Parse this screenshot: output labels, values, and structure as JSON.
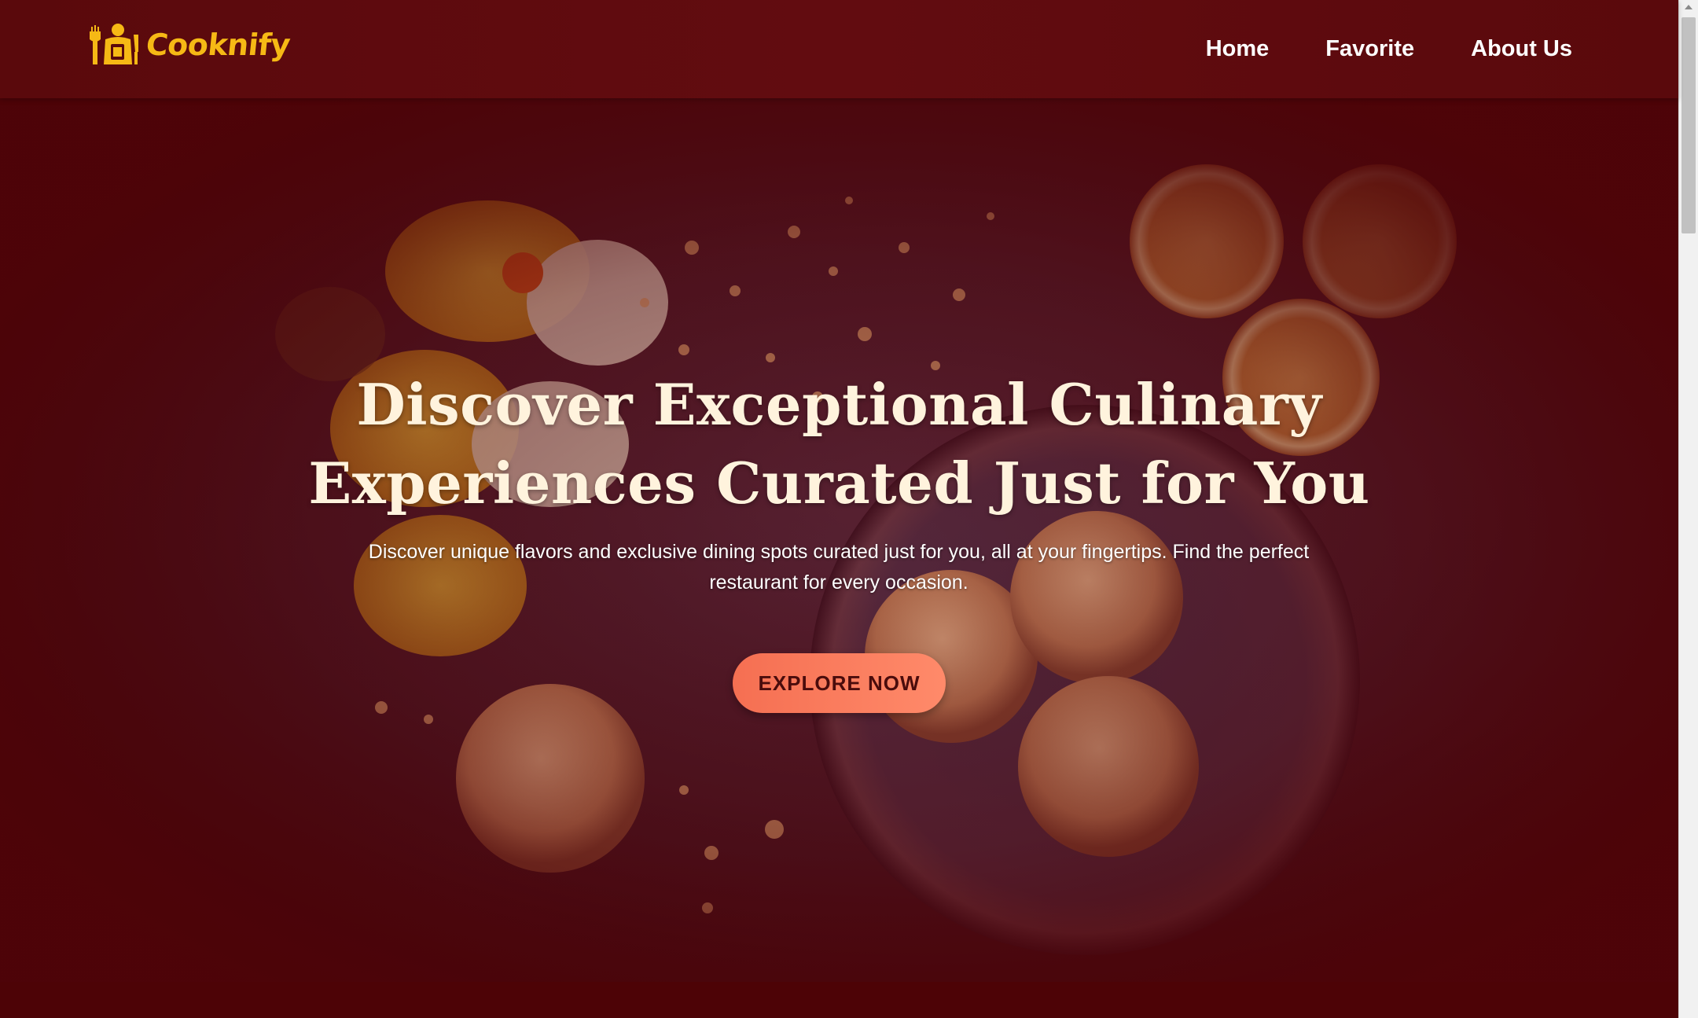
{
  "header": {
    "logo_text": "Cooknify",
    "brand_color": "#f6b915",
    "nav": [
      {
        "label": "Home"
      },
      {
        "label": "Favorite"
      },
      {
        "label": "About Us"
      }
    ]
  },
  "hero": {
    "title_line1": "Discover Exceptional Culinary",
    "title_line2": "Experiences Curated Just for You",
    "subtitle": "Discover unique flavors and exclusive dining spots curated just for you, all at your fingertips. Find the perfect restaurant for every occasion.",
    "cta_label": "EXPLORE NOW",
    "cta_color": "#f56f52"
  },
  "theme": {
    "background": "#4e0307",
    "text": "#ffffff"
  }
}
